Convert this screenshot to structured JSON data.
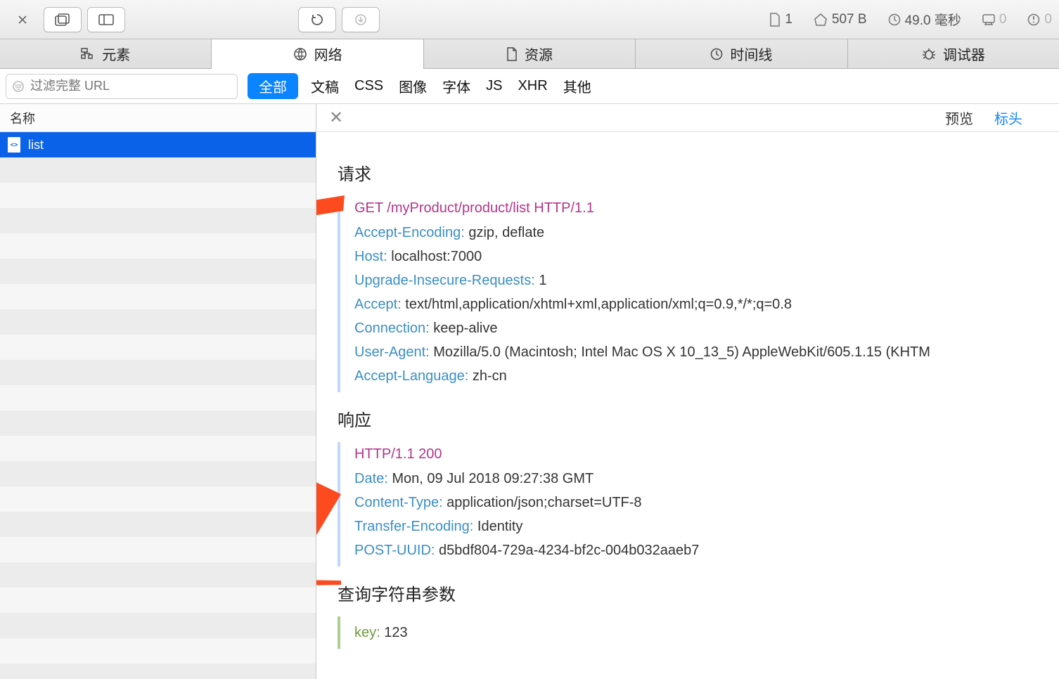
{
  "toolbar": {
    "stats": {
      "doc_count": "1",
      "size": "507 B",
      "time": "49.0 毫秒",
      "log_count": "0",
      "err_count": "0"
    }
  },
  "main_tabs": [
    {
      "label": "元素",
      "icon": "elements"
    },
    {
      "label": "网络",
      "icon": "network"
    },
    {
      "label": "资源",
      "icon": "resources"
    },
    {
      "label": "时间线",
      "icon": "timeline"
    },
    {
      "label": "调试器",
      "icon": "debugger"
    }
  ],
  "filter": {
    "placeholder": "过滤完整 URL",
    "all_label": "全部",
    "items": [
      "文稿",
      "CSS",
      "图像",
      "字体",
      "JS",
      "XHR",
      "其他"
    ]
  },
  "sidebar": {
    "header": "名称",
    "items": [
      {
        "name": "list"
      }
    ]
  },
  "detail": {
    "tabs": {
      "preview": "预览",
      "headers": "标头"
    },
    "request": {
      "title": "请求",
      "status": "GET /myProduct/product/list HTTP/1.1",
      "headers": [
        {
          "k": "Accept-Encoding:",
          "v": " gzip, deflate"
        },
        {
          "k": "Host:",
          "v": " localhost:7000"
        },
        {
          "k": "Upgrade-Insecure-Requests:",
          "v": " 1"
        },
        {
          "k": "Accept:",
          "v": " text/html,application/xhtml+xml,application/xml;q=0.9,*/*;q=0.8"
        },
        {
          "k": "Connection:",
          "v": " keep-alive"
        },
        {
          "k": "User-Agent:",
          "v": " Mozilla/5.0 (Macintosh; Intel Mac OS X 10_13_5) AppleWebKit/605.1.15 (KHTM"
        },
        {
          "k": "Accept-Language:",
          "v": " zh-cn"
        }
      ]
    },
    "response": {
      "title": "响应",
      "status": "HTTP/1.1 200",
      "headers": [
        {
          "k": "Date:",
          "v": " Mon, 09 Jul 2018 09:27:38 GMT"
        },
        {
          "k": "Content-Type:",
          "v": " application/json;charset=UTF-8"
        },
        {
          "k": "Transfer-Encoding:",
          "v": " Identity"
        },
        {
          "k": "POST-UUID:",
          "v": " d5bdf804-729a-4234-bf2c-004b032aaeb7"
        }
      ]
    },
    "query": {
      "title": "查询字符串参数",
      "params": [
        {
          "k": "key:",
          "v": " 123"
        }
      ]
    }
  }
}
